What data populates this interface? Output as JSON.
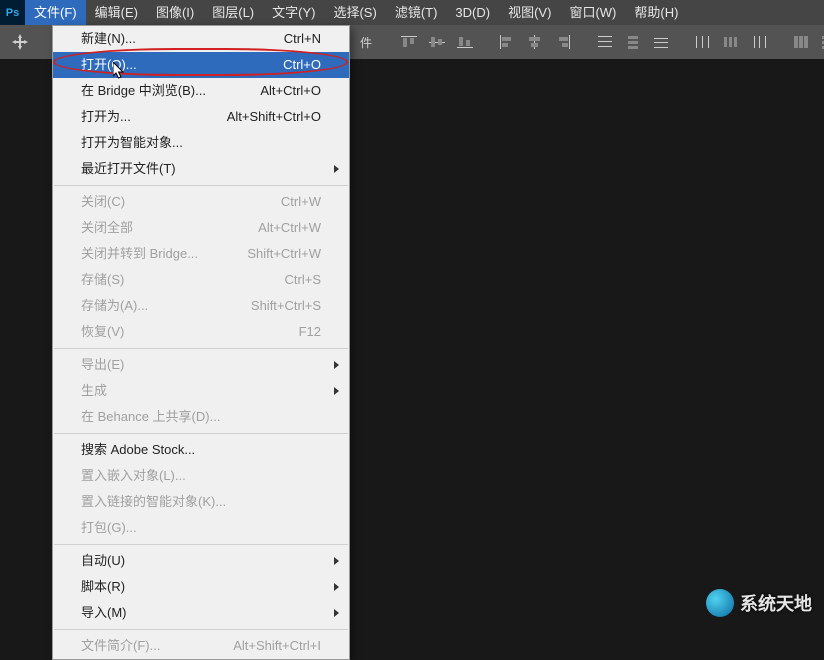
{
  "menubar": {
    "items": [
      {
        "label": "文件(F)",
        "active": true
      },
      {
        "label": "编辑(E)"
      },
      {
        "label": "图像(I)"
      },
      {
        "label": "图层(L)"
      },
      {
        "label": "文字(Y)"
      },
      {
        "label": "选择(S)"
      },
      {
        "label": "滤镜(T)"
      },
      {
        "label": "3D(D)"
      },
      {
        "label": "视图(V)"
      },
      {
        "label": "窗口(W)"
      },
      {
        "label": "帮助(H)"
      }
    ]
  },
  "options_bar": {
    "truncated_label": "件"
  },
  "file_menu": [
    {
      "type": "item",
      "label": "新建(N)...",
      "shortcut": "Ctrl+N"
    },
    {
      "type": "item",
      "label": "打开(O)...",
      "shortcut": "Ctrl+O",
      "selected": true
    },
    {
      "type": "item",
      "label": "在 Bridge 中浏览(B)...",
      "shortcut": "Alt+Ctrl+O"
    },
    {
      "type": "item",
      "label": "打开为...",
      "shortcut": "Alt+Shift+Ctrl+O"
    },
    {
      "type": "item",
      "label": "打开为智能对象..."
    },
    {
      "type": "item",
      "label": "最近打开文件(T)",
      "submenu": true
    },
    {
      "type": "sep"
    },
    {
      "type": "item",
      "label": "关闭(C)",
      "shortcut": "Ctrl+W",
      "disabled": true
    },
    {
      "type": "item",
      "label": "关闭全部",
      "shortcut": "Alt+Ctrl+W",
      "disabled": true
    },
    {
      "type": "item",
      "label": "关闭并转到 Bridge...",
      "shortcut": "Shift+Ctrl+W",
      "disabled": true
    },
    {
      "type": "item",
      "label": "存储(S)",
      "shortcut": "Ctrl+S",
      "disabled": true
    },
    {
      "type": "item",
      "label": "存储为(A)...",
      "shortcut": "Shift+Ctrl+S",
      "disabled": true
    },
    {
      "type": "item",
      "label": "恢复(V)",
      "shortcut": "F12",
      "disabled": true
    },
    {
      "type": "sep"
    },
    {
      "type": "item",
      "label": "导出(E)",
      "submenu": true,
      "disabled": true
    },
    {
      "type": "item",
      "label": "生成",
      "submenu": true,
      "disabled": true
    },
    {
      "type": "item",
      "label": "在 Behance 上共享(D)...",
      "disabled": true
    },
    {
      "type": "sep"
    },
    {
      "type": "item",
      "label": "搜索 Adobe Stock..."
    },
    {
      "type": "item",
      "label": "置入嵌入对象(L)...",
      "disabled": true
    },
    {
      "type": "item",
      "label": "置入链接的智能对象(K)...",
      "disabled": true
    },
    {
      "type": "item",
      "label": "打包(G)...",
      "disabled": true
    },
    {
      "type": "sep"
    },
    {
      "type": "item",
      "label": "自动(U)",
      "submenu": true
    },
    {
      "type": "item",
      "label": "脚本(R)",
      "submenu": true
    },
    {
      "type": "item",
      "label": "导入(M)",
      "submenu": true
    },
    {
      "type": "sep"
    },
    {
      "type": "item",
      "label": "文件简介(F)...",
      "shortcut": "Alt+Shift+Ctrl+I",
      "disabled": true
    }
  ],
  "watermark": {
    "text": "系统天地"
  },
  "app_icon": {
    "label": "Ps"
  }
}
